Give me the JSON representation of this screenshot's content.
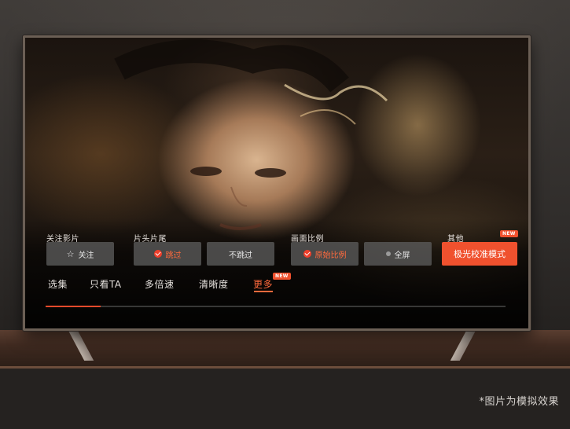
{
  "player_menu": {
    "groups": [
      {
        "label": "关注影片"
      },
      {
        "label": "片头片尾"
      },
      {
        "label": "画面比例"
      },
      {
        "label": "其他",
        "badge": "NEW"
      }
    ],
    "buttons": {
      "follow": {
        "label": "关注",
        "icon": "star-outline-icon",
        "selected": false
      },
      "skip": {
        "label": "跳过",
        "icon": "check-circle-icon",
        "selected": true
      },
      "no_skip": {
        "label": "不跳过",
        "selected": false
      },
      "original_ratio": {
        "label": "原始比例",
        "icon": "check-circle-icon",
        "selected": true
      },
      "fullscreen": {
        "label": "全屏",
        "selected": false
      },
      "calibration": {
        "label": "极光校准模式",
        "highlighted": true
      }
    },
    "tabs": [
      {
        "label": "选集",
        "active": false
      },
      {
        "label": "只看TA",
        "active": false
      },
      {
        "label": "多倍速",
        "active": false
      },
      {
        "label": "清晰度",
        "active": false
      },
      {
        "label": "更多",
        "active": true,
        "badge": "NEW"
      }
    ],
    "progress": 0.12
  },
  "colors": {
    "accent": "#f0512e",
    "selected_text": "#ff6a3d",
    "button_bg": "#5f5f5f"
  },
  "disclaimer": "*图片为模拟效果"
}
